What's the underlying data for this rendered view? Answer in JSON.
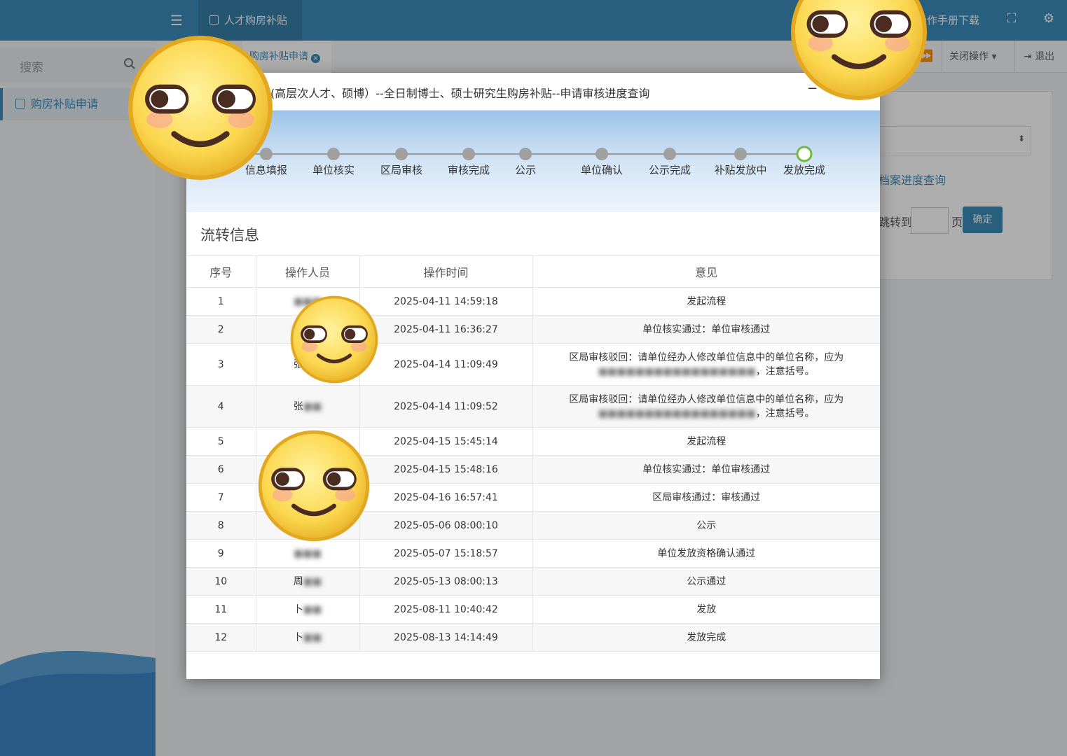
{
  "topbar": {
    "menu_icon": "menu-icon",
    "app_tab": "人才购房补贴",
    "manual_link": "操作手册下载",
    "fullscreen_icon": "fullscreen-icon",
    "settings_icon": "gears-icon"
  },
  "sidebar": {
    "search_placeholder": "搜索",
    "nav_item": "购房补贴申请"
  },
  "tabbar": {
    "active_tab": "购房补贴申请",
    "close_ops": "关闭操作",
    "logout": "退出"
  },
  "background": {
    "link": "档案进度查询",
    "jump_label": "跳转到",
    "page_unit": "页",
    "confirm_button": "确定"
  },
  "modal": {
    "title": "(高层次人才、硕博）--全日制博士、硕士研究生购房补贴--申请审核进度查询",
    "minimize": "−",
    "steps": [
      {
        "label": "信息填报"
      },
      {
        "label": "单位核实"
      },
      {
        "label": "区局审核"
      },
      {
        "label": "审核完成"
      },
      {
        "label": "公示"
      },
      {
        "label": "单位确认"
      },
      {
        "label": "公示完成"
      },
      {
        "label": "补贴发放中"
      },
      {
        "label": "发放完成"
      }
    ],
    "current_step_index": 8,
    "flow_title": "流转信息",
    "columns": [
      "序号",
      "操作人员",
      "操作时间",
      "意见"
    ],
    "rows": [
      {
        "no": "1",
        "operator": "■■■",
        "time": "2025-04-11 14:59:18",
        "opinion": "发起流程"
      },
      {
        "no": "2",
        "operator": "■■■",
        "time": "2025-04-11 16:36:27",
        "opinion": "单位核实通过：单位审核通过"
      },
      {
        "no": "3",
        "operator": "张■■",
        "time": "2025-04-14 11:09:49",
        "opinion": "区局审核驳回：请单位经办人修改单位信息中的单位名称，应为■■■■■■■■■■■■■■■■■，注意括号。"
      },
      {
        "no": "4",
        "operator": "张■■",
        "time": "2025-04-14 11:09:52",
        "opinion": "区局审核驳回：请单位经办人修改单位信息中的单位名称，应为■■■■■■■■■■■■■■■■■，注意括号。"
      },
      {
        "no": "5",
        "operator": "■■■",
        "time": "2025-04-15 15:45:14",
        "opinion": "发起流程"
      },
      {
        "no": "6",
        "operator": "■■■",
        "time": "2025-04-15 15:48:16",
        "opinion": "单位核实通过：单位审核通过"
      },
      {
        "no": "7",
        "operator": "■■■",
        "time": "2025-04-16 16:57:41",
        "opinion": "区局审核通过：审核通过"
      },
      {
        "no": "8",
        "operator": "■■■",
        "time": "2025-05-06 08:00:10",
        "opinion": "公示"
      },
      {
        "no": "9",
        "operator": "■■■",
        "time": "2025-05-07 15:18:57",
        "opinion": "单位发放资格确认通过"
      },
      {
        "no": "10",
        "operator": "周■■",
        "time": "2025-05-13 08:00:13",
        "opinion": "公示通过"
      },
      {
        "no": "11",
        "operator": "卜■■",
        "time": "2025-08-11 10:40:42",
        "opinion": "发放"
      },
      {
        "no": "12",
        "operator": "卜■■",
        "time": "2025-08-13 14:14:49",
        "opinion": "发放完成"
      }
    ]
  },
  "colors": {
    "primary": "#3c8dbc",
    "step_done": "#a0a0a0",
    "step_current": "#6fb93f"
  }
}
